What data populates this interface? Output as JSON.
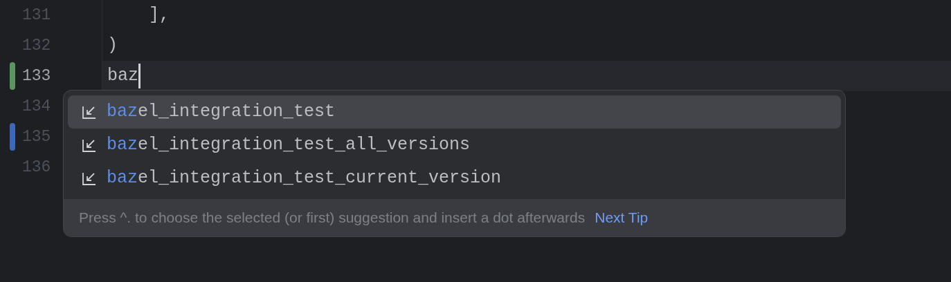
{
  "editor": {
    "lines": [
      {
        "number": "131",
        "code": "    ],",
        "current": false
      },
      {
        "number": "132",
        "code": ")",
        "current": false
      },
      {
        "number": "133",
        "code": "baz",
        "current": true,
        "caret": true,
        "color": "#5b9660"
      },
      {
        "number": "134",
        "current": false
      },
      {
        "number": "135",
        "current": false,
        "color": "#3d68b8"
      },
      {
        "number": "136",
        "current": false
      }
    ]
  },
  "completion": {
    "items": [
      {
        "match": "baz",
        "rest": "el_integration_test",
        "selected": true
      },
      {
        "match": "baz",
        "rest": "el_integration_test_all_versions",
        "selected": false
      },
      {
        "match": "baz",
        "rest": "el_integration_test_current_version",
        "selected": false
      }
    ],
    "tip": "Press ^. to choose the selected (or first) suggestion and insert a dot afterwards",
    "tip_link": "Next Tip"
  }
}
